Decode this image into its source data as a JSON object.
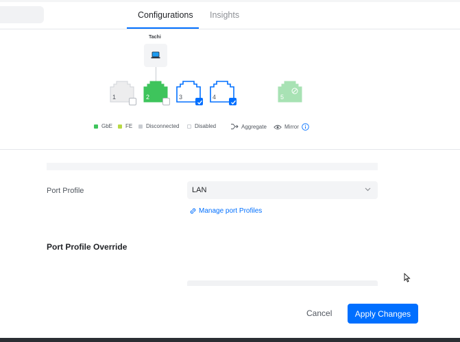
{
  "tabs": [
    {
      "label": "Configurations",
      "active": true
    },
    {
      "label": "Insights",
      "active": false
    }
  ],
  "device": {
    "name": "Tachi",
    "icon": "laptop-icon"
  },
  "ports": [
    {
      "number": "1",
      "state": "disconnected",
      "selected": false
    },
    {
      "number": "2",
      "state": "gbe",
      "selected": false
    },
    {
      "number": "3",
      "state": "disconnected",
      "selected": true
    },
    {
      "number": "4",
      "state": "disconnected",
      "selected": true
    },
    {
      "number": "5",
      "state": "gbe-disabled",
      "selected": false
    }
  ],
  "legend": {
    "gbe": "GbE",
    "fe": "FE",
    "disconnected": "Disconnected",
    "disabled": "Disabled",
    "aggregate": "Aggregate",
    "mirror": "Mirror"
  },
  "colors": {
    "accent": "#006fff",
    "gbe": "#3ec45c",
    "fe": "#b8d943",
    "disconnected": "#c9ccd1"
  },
  "form": {
    "port_profile_label": "Port Profile",
    "port_profile_value": "LAN",
    "manage_link": "Manage port Profiles",
    "override_title": "Port Profile Override"
  },
  "actions": {
    "cancel": "Cancel",
    "apply": "Apply Changes"
  }
}
